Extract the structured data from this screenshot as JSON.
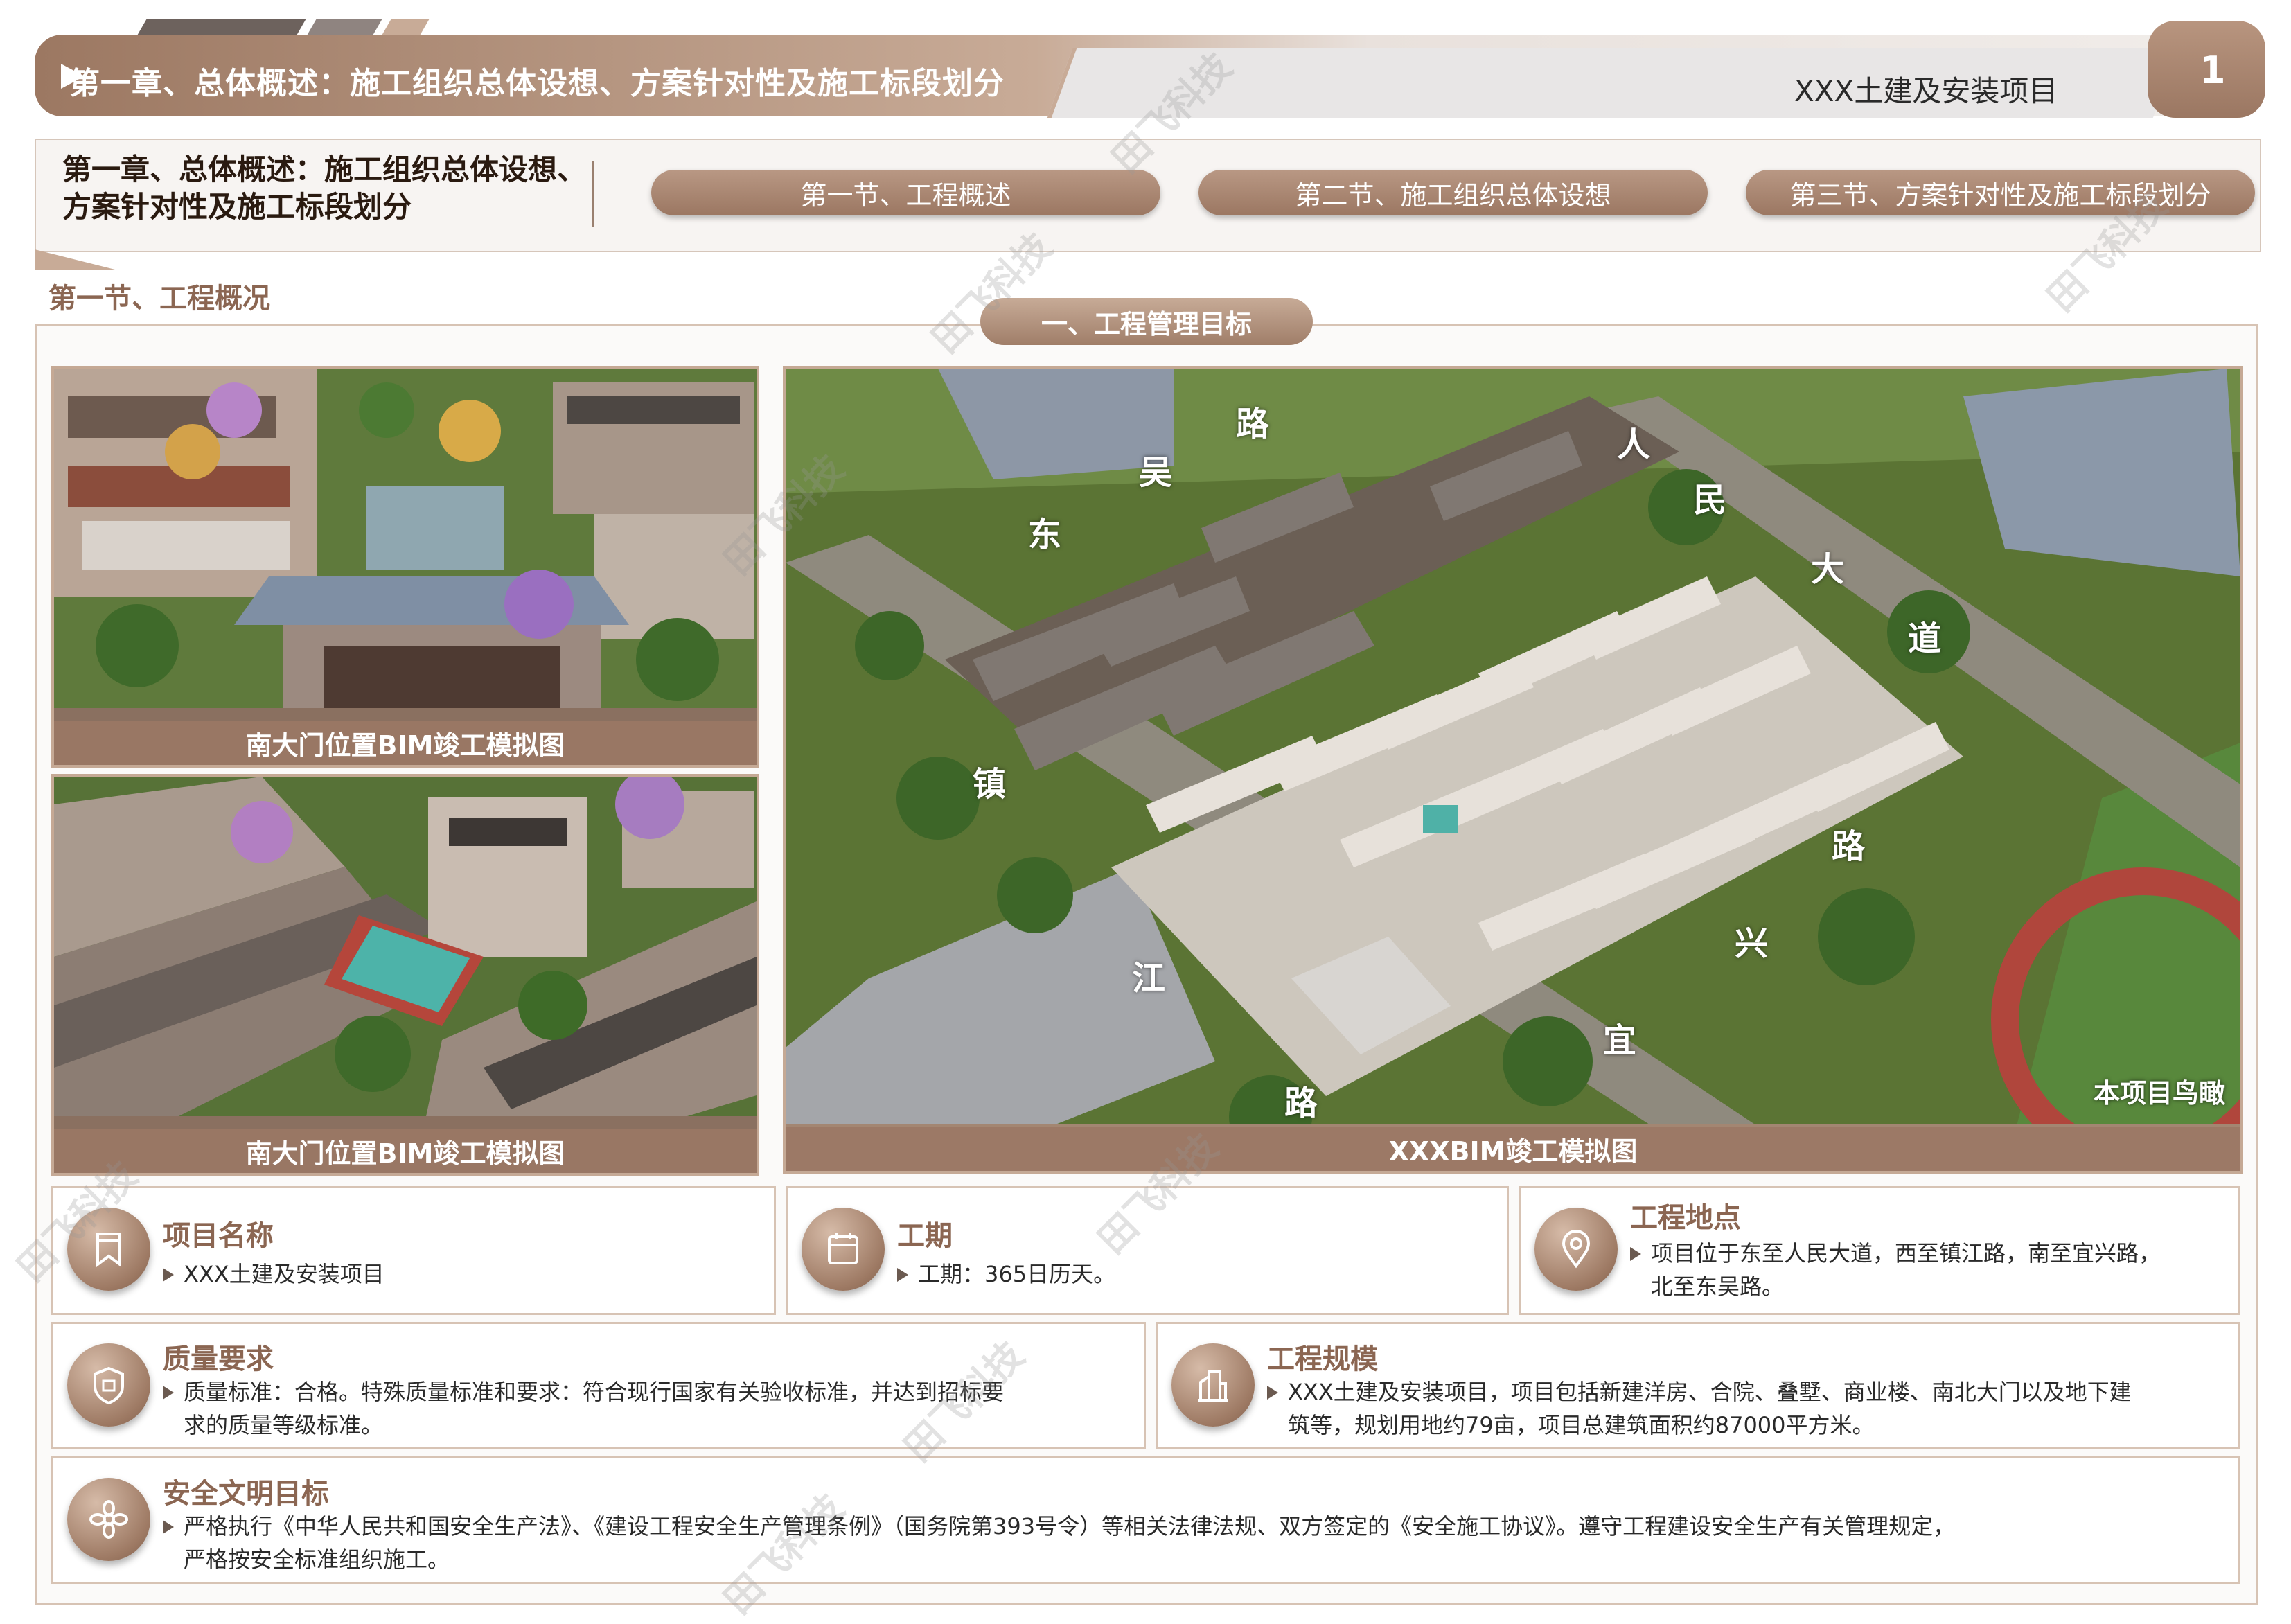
{
  "header": {
    "chapter_banner": "第一章、总体概述：施工组织总体设想、方案针对性及施工标段划分",
    "project_title": "XXX土建及安装项目",
    "page_number": "1"
  },
  "nav": {
    "chapter_title_line1": "第一章、总体概述：施工组织总体设想、",
    "chapter_title_line2": "方案针对性及施工标段划分",
    "tabs": [
      {
        "label": "第一节、工程概述"
      },
      {
        "label": "第二节、施工组织总体设想"
      },
      {
        "label": "第三节、方案针对性及施工标段划分"
      }
    ]
  },
  "section": {
    "heading": "第一节、工程概况",
    "subheading": "一、工程管理目标"
  },
  "images": {
    "gate1_caption": "南大门位置BIM竣工模拟图",
    "gate2_caption": "南大门位置BIM竣工模拟图",
    "aerial_caption": "XXXBIM竣工模拟图",
    "aerial_badge": "本项目鸟瞰",
    "road_labels": [
      "东",
      "吴",
      "路",
      "人",
      "民",
      "大",
      "道",
      "路",
      "兴",
      "宜",
      "路",
      "江",
      "镇"
    ]
  },
  "cards": {
    "name": {
      "title": "项目名称",
      "text": "XXX土建及安装项目",
      "icon": "bookmark-icon"
    },
    "period": {
      "title": "工期",
      "text": "工期：365日历天。",
      "icon": "calendar-icon"
    },
    "location": {
      "title": "工程地点",
      "text_line1": "项目位于东至人民大道，西至镇江路，南至宜兴路，",
      "text_line2": "北至东吴路。",
      "icon": "location-pin-icon"
    },
    "quality": {
      "title": "质量要求",
      "text_line1": "质量标准：合格。特殊质量标准和要求：符合现行国家有关验收标准，并达到招标要",
      "text_line2": "求的质量等级标准。",
      "icon": "quality-badge-icon"
    },
    "scale": {
      "title": "工程规模",
      "text_line1": "XXX土建及安装项目，项目包括新建洋房、合院、叠墅、商业楼、南北大门以及地下建",
      "text_line2": "筑等，规划用地约79亩，项目总建筑面积约87000平方米。",
      "icon": "building-icon"
    },
    "safety": {
      "title": "安全文明目标",
      "text_line1": "严格执行《中华人民共和国安全生产法》、《建设工程安全生产管理条例》（国务院第393号令）等相关法律法规、双方签定的《安全施工协议》。遵守工程建设安全生产有关管理规定，",
      "text_line2": "严格按安全标准组织施工。",
      "icon": "flower-icon"
    }
  },
  "watermark": "田飞科技",
  "colors": {
    "accent": "#9b7762",
    "accent_light": "#c8ab97",
    "title_brown": "#8b6652"
  }
}
